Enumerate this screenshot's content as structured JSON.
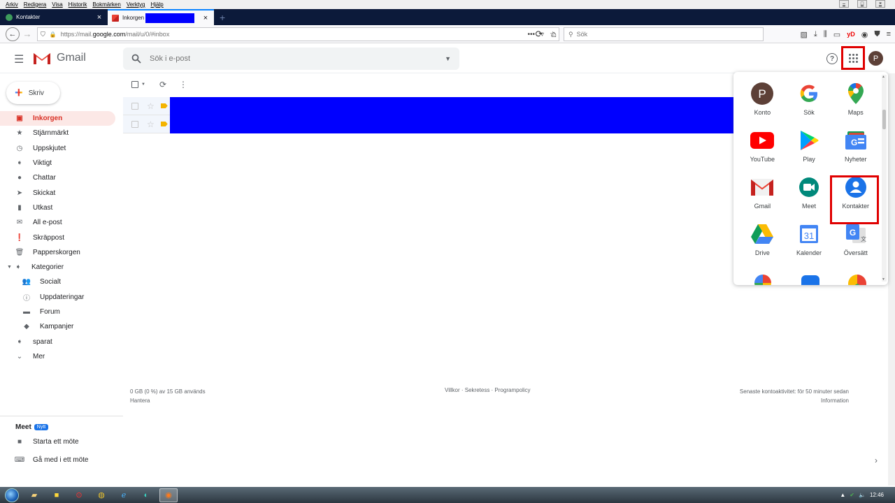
{
  "browser": {
    "menu": [
      "Arkiv",
      "Redigera",
      "Visa",
      "Historik",
      "Bokmärken",
      "Verktyg",
      "Hjälp"
    ],
    "tabs": [
      {
        "title": "Kontakter",
        "active": false
      },
      {
        "title": "Inkorgen - p",
        "active": true
      }
    ],
    "url": {
      "prefix": "https://mail.",
      "host": "google.com",
      "path": "/mail/u/0/#inbox"
    },
    "search_placeholder": "Sök",
    "addon_label": "yD"
  },
  "gmail": {
    "brand": "Gmail",
    "search_placeholder": "Sök i e-post",
    "avatar_letter": "P",
    "help_label": "?",
    "compose_label": "Skriv",
    "nav": [
      {
        "label": "Inkorgen",
        "icon": "inbox-icon",
        "active": true
      },
      {
        "label": "Stjärnmärkt",
        "icon": "star-icon"
      },
      {
        "label": "Uppskjutet",
        "icon": "clock-icon"
      },
      {
        "label": "Viktigt",
        "icon": "important-icon"
      },
      {
        "label": "Chattar",
        "icon": "chat-icon"
      },
      {
        "label": "Skickat",
        "icon": "send-icon"
      },
      {
        "label": "Utkast",
        "icon": "draft-icon"
      },
      {
        "label": "All e-post",
        "icon": "mail-icon"
      },
      {
        "label": "Skräppost",
        "icon": "spam-icon"
      },
      {
        "label": "Papperskorgen",
        "icon": "trash-icon"
      }
    ],
    "categories_label": "Kategorier",
    "categories": [
      {
        "label": "Socialt",
        "icon": "people-icon"
      },
      {
        "label": "Uppdateringar",
        "icon": "info-icon"
      },
      {
        "label": "Forum",
        "icon": "forum-icon"
      },
      {
        "label": "Kampanjer",
        "icon": "tag-icon"
      }
    ],
    "saved_label": "sparat",
    "more_label": "Mer",
    "meet": {
      "title": "Meet",
      "badge": "Nytt",
      "items": [
        {
          "label": "Starta ett möte",
          "icon": "video-icon"
        },
        {
          "label": "Gå med i ett möte",
          "icon": "keyboard-icon"
        }
      ]
    },
    "footer": {
      "storage": "0 GB (0 %) av 15 GB används",
      "manage": "Hantera",
      "links": "Villkor · Sekretess · Programpolicy",
      "activity": "Senaste kontoaktivitet: för 50 minuter sedan",
      "details": "Information"
    },
    "apps": [
      {
        "label": "Konto",
        "icon": "account-icon"
      },
      {
        "label": "Sök",
        "icon": "google-icon"
      },
      {
        "label": "Maps",
        "icon": "maps-icon"
      },
      {
        "label": "YouTube",
        "icon": "youtube-icon"
      },
      {
        "label": "Play",
        "icon": "play-icon"
      },
      {
        "label": "Nyheter",
        "icon": "news-icon"
      },
      {
        "label": "Gmail",
        "icon": "gmail-icon"
      },
      {
        "label": "Meet",
        "icon": "meet-icon"
      },
      {
        "label": "Kontakter",
        "icon": "contacts-icon"
      },
      {
        "label": "Drive",
        "icon": "drive-icon"
      },
      {
        "label": "Kalender",
        "icon": "calendar-icon",
        "day": "31"
      },
      {
        "label": "Översätt",
        "icon": "translate-icon"
      }
    ]
  },
  "taskbar": {
    "clock": "12:46"
  },
  "colors": {
    "highlight": "#e00000",
    "redaction": "#0000ff",
    "active_nav": "#d93025"
  }
}
